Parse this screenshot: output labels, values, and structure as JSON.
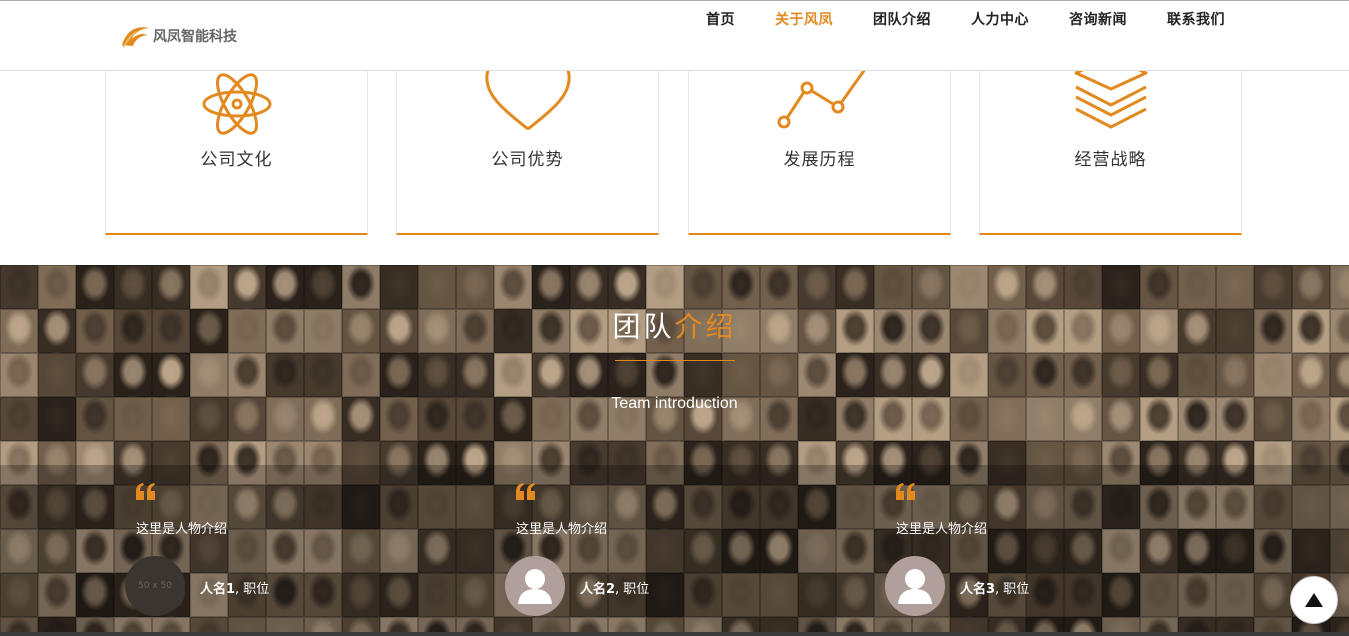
{
  "header": {
    "logo_text": "风凤智能科技",
    "nav": [
      {
        "label": "首页",
        "active": false
      },
      {
        "label": "关于风凤",
        "active": true
      },
      {
        "label": "团队介绍",
        "active": false
      },
      {
        "label": "人力中心",
        "active": false
      },
      {
        "label": "咨询新闻",
        "active": false
      },
      {
        "label": "联系我们",
        "active": false
      }
    ]
  },
  "features": [
    {
      "title": "公司文化",
      "icon": "atom-icon"
    },
    {
      "title": "公司优势",
      "icon": "heart-icon"
    },
    {
      "title": "发展历程",
      "icon": "line-chart-icon"
    },
    {
      "title": "经营战略",
      "icon": "layers-icon"
    }
  ],
  "team": {
    "title_main": "团队",
    "title_accent": "介绍",
    "subtitle": "Team introduction",
    "members": [
      {
        "intro": "这里是人物介绍",
        "name": "人名1",
        "role": ", 职位",
        "avatar_text": "50 x 50"
      },
      {
        "intro": "这里是人物介绍",
        "name": "人名2",
        "role": ", 职位"
      },
      {
        "intro": "这里是人物介绍",
        "name": "人名3",
        "role": ", 职位"
      }
    ]
  },
  "colors": {
    "accent": "#e28a1f",
    "text_dark": "#333333"
  }
}
